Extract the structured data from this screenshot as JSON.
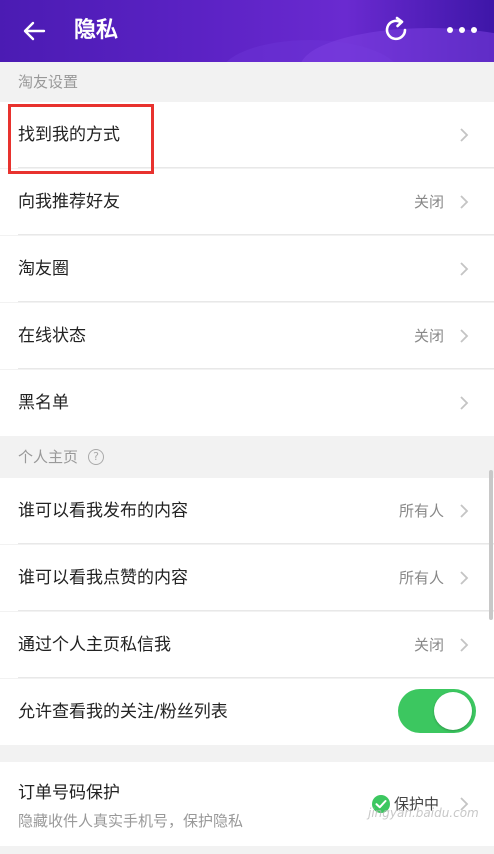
{
  "header": {
    "title": "隐私"
  },
  "sections": {
    "taoyou": "淘友设置",
    "homepage": "个人主页"
  },
  "rows": {
    "find_me": {
      "label": "找到我的方式",
      "value": ""
    },
    "recommend": {
      "label": "向我推荐好友",
      "value": "关闭"
    },
    "circle": {
      "label": "淘友圈",
      "value": ""
    },
    "online": {
      "label": "在线状态",
      "value": "关闭"
    },
    "blacklist": {
      "label": "黑名单",
      "value": ""
    },
    "who_posts": {
      "label": "谁可以看我发布的内容",
      "value": "所有人"
    },
    "who_likes": {
      "label": "谁可以看我点赞的内容",
      "value": "所有人"
    },
    "private_msg": {
      "label": "通过个人主页私信我",
      "value": "关闭"
    },
    "follow_list": {
      "label": "允许查看我的关注/粉丝列表",
      "toggle_on": true
    }
  },
  "order_protection": {
    "label": "订单号码保护",
    "sub": "隐藏收件人真实手机号，保护隐私",
    "status": "保护中"
  },
  "watermark": "jingyan.baidu.com",
  "colors": {
    "header": "#5b22c4",
    "toggle_on": "#3cc760",
    "highlight": "#e8322e"
  }
}
